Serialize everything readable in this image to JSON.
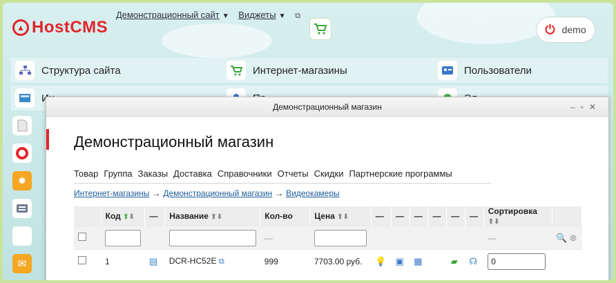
{
  "brand": {
    "name": "HostCMS"
  },
  "topnav": {
    "site": "Демонстрационный сайт",
    "widgets": "Виджеты"
  },
  "user": {
    "name": "demo"
  },
  "dashboard": {
    "row1": [
      "Структура сайта",
      "Интернет-магазины",
      "Пользователи"
    ],
    "row2": [
      "Ин",
      "Пр",
      "Эл"
    ]
  },
  "modal": {
    "window_title": "Демонстрационный магазин",
    "page_title": "Демонстрационный магазин",
    "menu": [
      "Товар",
      "Группа",
      "Заказы",
      "Доставка",
      "Справочники",
      "Отчеты",
      "Скидки",
      "Партнерские программы"
    ],
    "breadcrumbs": [
      "Интернет-магазины",
      "Демонстрационный магазин",
      "Видеокамеры"
    ],
    "table": {
      "headers": {
        "code": "Код",
        "dash": "—",
        "name": "Название",
        "qty": "Кол-во",
        "price": "Цена",
        "sort": "Сортировка"
      },
      "rows": [
        {
          "code": "1",
          "name": "DCR-HC52E",
          "qty": "999",
          "price": "7703.00 руб.",
          "sort": "0"
        }
      ]
    }
  },
  "colors": {
    "accent": "#e2252b",
    "link": "#1c5d9a"
  }
}
